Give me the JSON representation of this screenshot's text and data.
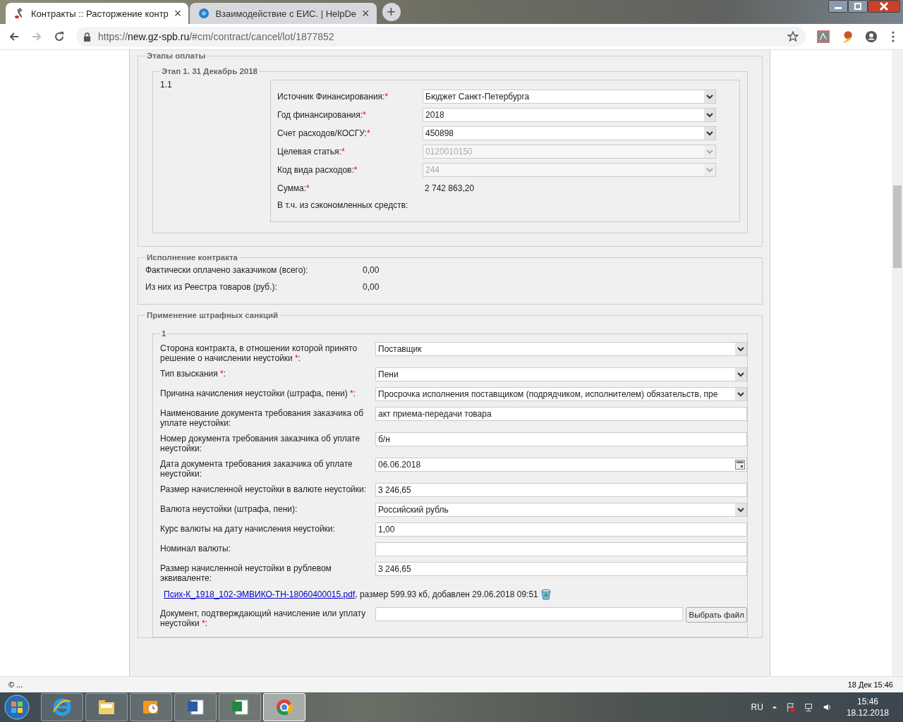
{
  "browser": {
    "tabs": [
      {
        "title": "Контракты :: Расторжение контр",
        "selected": true,
        "close": "×"
      },
      {
        "title": "Взаимодействие с ЕИС. | HelpDe",
        "selected": false,
        "close": "×"
      }
    ],
    "new_tab": "+",
    "url": {
      "scheme": "https://",
      "host": "new.gz-spb.ru",
      "path": "/#cm/contract/cancel/lot/1877852"
    }
  },
  "payment_stages": {
    "title": "Этапы оплаты",
    "stage": {
      "title": "Этап 1. 31 Декабрь 2018",
      "number": "1.1",
      "fields": [
        {
          "label": "Источник Финансирования:",
          "required": "*",
          "kind": "select",
          "value": "Бюджет Санкт-Петербурга",
          "disabled": false
        },
        {
          "label": "Год финансирования:",
          "required": "*",
          "kind": "select",
          "value": "2018",
          "disabled": false
        },
        {
          "label": "Счет расходов/КОСГУ:",
          "required": "*",
          "kind": "select",
          "value": "450898",
          "disabled": false
        },
        {
          "label": "Целевая статья:",
          "required": "*",
          "kind": "select",
          "value": "0120010150",
          "disabled": true
        },
        {
          "label": "Код вида расходов:",
          "required": "*",
          "kind": "select",
          "value": "244",
          "disabled": true
        },
        {
          "label": "Сумма:",
          "required": "*",
          "kind": "static",
          "value": "2 742 863,20"
        },
        {
          "label": "В т.ч. из сэкономленных средств:",
          "kind": "static"
        }
      ]
    }
  },
  "execution": {
    "title": "Исполнение контракта",
    "rows": [
      {
        "label": "Фактически оплачено заказчиком (всего):",
        "value": "0,00"
      },
      {
        "label": "Из них из Реестра товаров (руб.):",
        "value": "0,00"
      }
    ]
  },
  "penalties": {
    "title": "Применение штрафных санкций",
    "item": {
      "title": "1",
      "fields": [
        {
          "label": "Сторона контракта, в отношении которой принято решение о начислении неустойки ",
          "required": "*",
          "tail": ":",
          "kind": "select",
          "value": "Поставщик"
        },
        {
          "label": "Тип взыскания ",
          "required": "*",
          "tail": ":",
          "kind": "select",
          "value": "Пени"
        },
        {
          "label": "Причина начисления неустойки (штрафа, пени) ",
          "required": "*",
          "tail": ":",
          "kind": "select",
          "value": "Просрочка исполнения поставщиком (подрядчиком, исполнителем) обязательств, пре"
        },
        {
          "label": "Наименование документа требования заказчика об уплате неустойки:",
          "kind": "text",
          "value": "акт приема-передачи товара"
        },
        {
          "label": "Номер документа требования заказчика об уплате неустойки:",
          "kind": "text",
          "value": "б/н"
        },
        {
          "label": "Дата документа требования заказчика об уплате неустойки:",
          "kind": "date",
          "value": "06.06.2018"
        },
        {
          "label": "Размер начисленной неустойки в валюте неустойки:",
          "kind": "text",
          "value": "3 246,65"
        },
        {
          "label": "Валюта неустойки (штрафа, пени):",
          "kind": "select",
          "value": "Российский рубль"
        },
        {
          "label": "Курс валюты на дату начисления неустойки:",
          "kind": "text",
          "value": "1,00"
        },
        {
          "label": "Номинал валюты:",
          "kind": "text"
        },
        {
          "label": "Размер начисленной неустойки в рублевом эквиваленте:",
          "kind": "text",
          "value": "3 246,65"
        }
      ],
      "attachment": {
        "link": "Псих-К_1918_102-ЭМВИКО-ТН-18060400015.pdf",
        "info": ", размер 599.93 кб, добавлен 29.06.2018 09:51"
      },
      "upload": {
        "label": "Документ, подтверждающий начисление или уплату неустойки ",
        "required": "*",
        "tail": ":",
        "button": "Выбрать файл"
      }
    }
  },
  "status_bar": {
    "left": "© ...",
    "right": "18 Дек 15:46"
  },
  "taskbar": {
    "apps": [
      {
        "kind": "ie",
        "selected": false
      },
      {
        "kind": "explorer",
        "selected": false
      },
      {
        "kind": "outlook",
        "selected": false
      },
      {
        "kind": "word",
        "selected": false
      },
      {
        "kind": "excel",
        "selected": false
      },
      {
        "kind": "chrome",
        "selected": true
      }
    ],
    "language": "RU",
    "time": "15:46",
    "date": "18.12.2018"
  }
}
